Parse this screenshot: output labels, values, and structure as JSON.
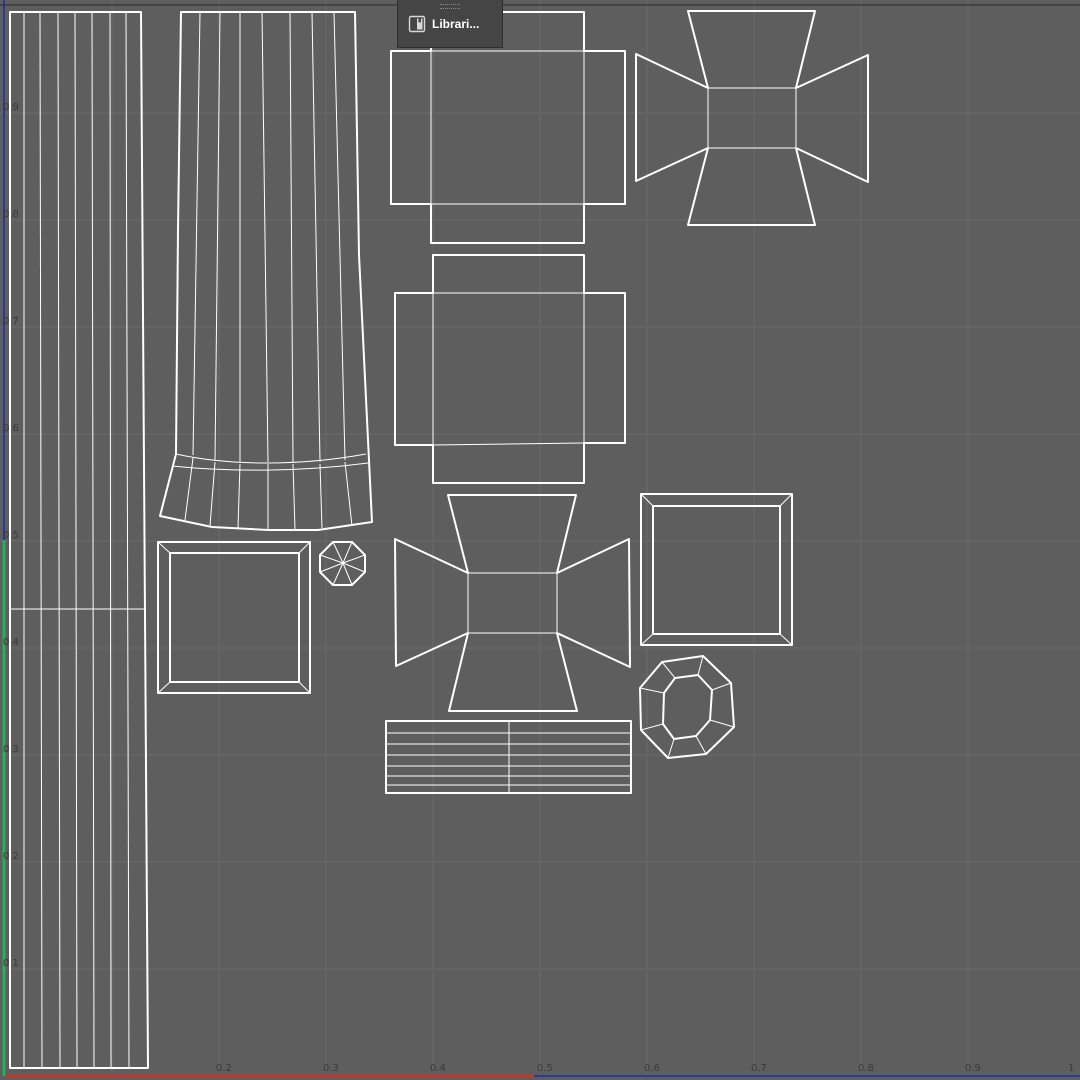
{
  "panel": {
    "library_label": "Librari...",
    "icon": "library-icon"
  },
  "axes": {
    "u_ticks": [
      "0.2",
      "0.3",
      "0.4",
      "0.5",
      "0.6",
      "0.7",
      "0.8",
      "0.9",
      "1"
    ],
    "v_ticks": [
      "0.9",
      "0.8",
      "0.7",
      "0.6",
      "0.5",
      "0.4",
      "0.3",
      "0.2",
      "0.1"
    ]
  },
  "colors": {
    "background": "#5e5e5e",
    "grid": "#6a6a6a",
    "uv_line": "#ffffff",
    "u_axis": "#c0392b",
    "v_axis": "#27ae60",
    "border": "#2a3a9a"
  }
}
